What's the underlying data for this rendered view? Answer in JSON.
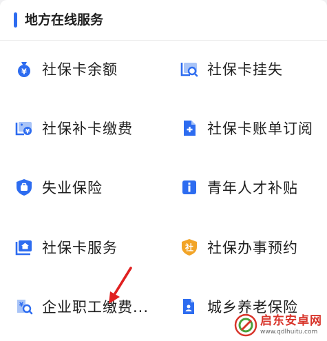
{
  "section": {
    "title": "地方在线服务"
  },
  "services": [
    {
      "label": "社保卡余额",
      "icon": "money-bag-icon"
    },
    {
      "label": "社保卡挂失",
      "icon": "card-search-icon"
    },
    {
      "label": "社保补卡缴费",
      "icon": "card-payment-icon"
    },
    {
      "label": "社保卡账单订阅",
      "icon": "document-add-icon"
    },
    {
      "label": "失业保险",
      "icon": "shield-briefcase-icon"
    },
    {
      "label": "青年人才补贴",
      "icon": "info-icon"
    },
    {
      "label": "社保卡服务",
      "icon": "card-home-icon"
    },
    {
      "label": "社保办事预约",
      "icon": "shield-she-icon"
    },
    {
      "label": "企业职工缴费...",
      "icon": "money-search-icon"
    },
    {
      "label": "城乡养老保险",
      "icon": "document-person-icon"
    }
  ],
  "icon_text": {
    "she": "社"
  },
  "watermark": {
    "title": "启东安卓网",
    "url": "www.qdlhuitu.com"
  },
  "colors": {
    "accent": "#2d6cf0",
    "icon_orange": "#f2a427",
    "arrow": "#e02020",
    "watermark": "#d8342a"
  }
}
